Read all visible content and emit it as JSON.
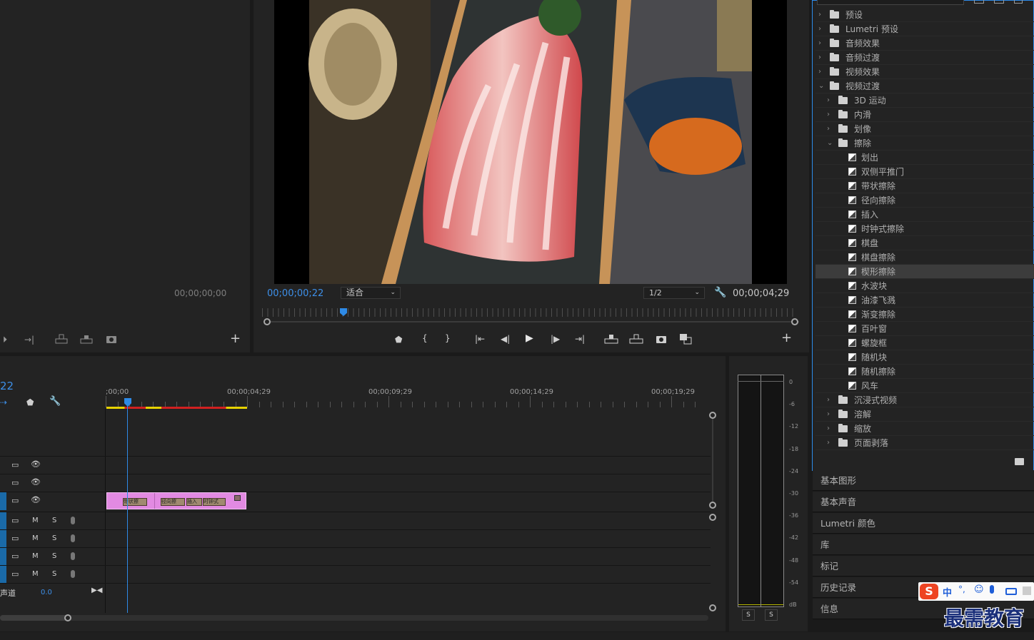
{
  "source_monitor": {
    "timecode": "00;00;00;00"
  },
  "program_monitor": {
    "current_time": "00;00;00;22",
    "fit_select": "适合",
    "resolution_select": "1/2",
    "duration": "00;00;04;29"
  },
  "timeline": {
    "current_time_short": "22",
    "ruler_labels": [
      ";00;00",
      "00;00;04;29",
      "00;00;09;29",
      "00;00;14;29",
      "00;00;19;29"
    ],
    "audio_track_labels": {
      "m": "M",
      "s": "S"
    },
    "master_label": "声道",
    "master_value": "0.0",
    "clip_transitions": [
      "带状擦",
      "径向擦",
      "插入",
      "时钟式"
    ],
    "colors": {
      "clip": "#e28ae2",
      "playhead": "#2e8ae6",
      "render_bar_yellow": "#e6d200",
      "render_bar_red": "#d12020"
    }
  },
  "effects": {
    "tree": [
      {
        "label": "预设",
        "type": "folder",
        "depth": 0,
        "expanded": false
      },
      {
        "label": "Lumetri 预设",
        "type": "folder",
        "depth": 0,
        "expanded": false
      },
      {
        "label": "音频效果",
        "type": "folder",
        "depth": 0,
        "expanded": false
      },
      {
        "label": "音频过渡",
        "type": "folder",
        "depth": 0,
        "expanded": false
      },
      {
        "label": "视频效果",
        "type": "folder",
        "depth": 0,
        "expanded": false
      },
      {
        "label": "视频过渡",
        "type": "folder",
        "depth": 0,
        "expanded": true
      },
      {
        "label": "3D 运动",
        "type": "folder",
        "depth": 1,
        "expanded": false
      },
      {
        "label": "内滑",
        "type": "folder",
        "depth": 1,
        "expanded": false
      },
      {
        "label": "划像",
        "type": "folder",
        "depth": 1,
        "expanded": false
      },
      {
        "label": "擦除",
        "type": "folder",
        "depth": 1,
        "expanded": true
      },
      {
        "label": "划出",
        "type": "effect",
        "depth": 2
      },
      {
        "label": "双侧平推门",
        "type": "effect",
        "depth": 2
      },
      {
        "label": "带状擦除",
        "type": "effect",
        "depth": 2
      },
      {
        "label": "径向擦除",
        "type": "effect",
        "depth": 2
      },
      {
        "label": "插入",
        "type": "effect",
        "depth": 2
      },
      {
        "label": "时钟式擦除",
        "type": "effect",
        "depth": 2
      },
      {
        "label": "棋盘",
        "type": "effect",
        "depth": 2
      },
      {
        "label": "棋盘擦除",
        "type": "effect",
        "depth": 2
      },
      {
        "label": "楔形擦除",
        "type": "effect",
        "depth": 2,
        "selected": true
      },
      {
        "label": "水波块",
        "type": "effect",
        "depth": 2
      },
      {
        "label": "油漆飞溅",
        "type": "effect",
        "depth": 2
      },
      {
        "label": "渐变擦除",
        "type": "effect",
        "depth": 2
      },
      {
        "label": "百叶窗",
        "type": "effect",
        "depth": 2
      },
      {
        "label": "螺旋框",
        "type": "effect",
        "depth": 2
      },
      {
        "label": "随机块",
        "type": "effect",
        "depth": 2
      },
      {
        "label": "随机擦除",
        "type": "effect",
        "depth": 2
      },
      {
        "label": "风车",
        "type": "effect",
        "depth": 2
      },
      {
        "label": "沉浸式视频",
        "type": "folder",
        "depth": 1,
        "expanded": false
      },
      {
        "label": "溶解",
        "type": "folder",
        "depth": 1,
        "expanded": false
      },
      {
        "label": "缩放",
        "type": "folder",
        "depth": 1,
        "expanded": false
      },
      {
        "label": "页面剥落",
        "type": "folder",
        "depth": 1,
        "expanded": false
      }
    ]
  },
  "side_panels": [
    "基本图形",
    "基本声音",
    "Lumetri 颜色",
    "库",
    "标记",
    "历史记录",
    "信息"
  ],
  "audio_meter": {
    "scale": [
      "0",
      "-6",
      "-12",
      "-18",
      "-24",
      "-30",
      "-36",
      "-42",
      "-48",
      "-54",
      "dB"
    ],
    "solo_labels": [
      "S",
      "S"
    ]
  },
  "ime_toolbar": {
    "lang": "中"
  },
  "watermark": {
    "text": "最需教育"
  }
}
